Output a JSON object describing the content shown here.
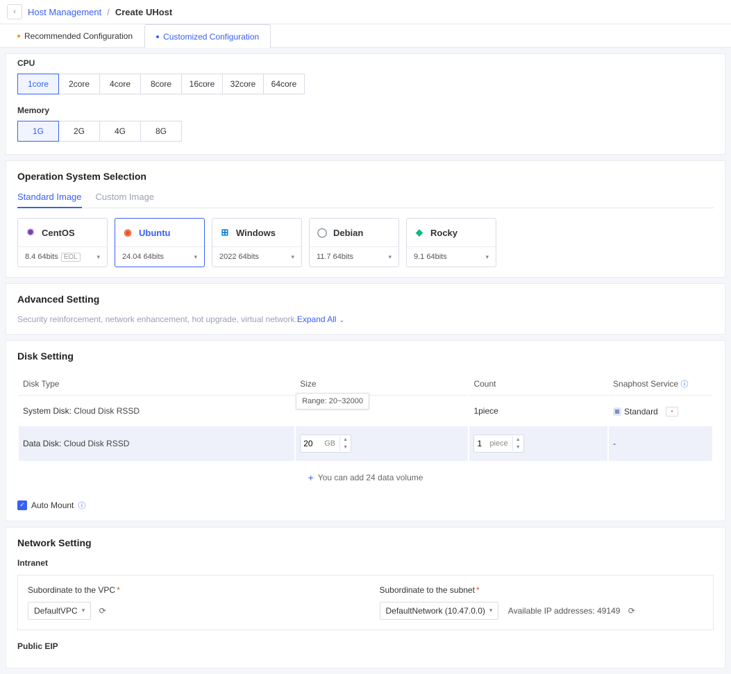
{
  "breadcrumb": {
    "parent": "Host Management",
    "sep": "/",
    "current": "Create UHost"
  },
  "tabs": {
    "recommended": "Recommended Configuration",
    "customized": "Customized Configuration"
  },
  "cpu": {
    "label": "CPU",
    "options": [
      "1core",
      "2core",
      "4core",
      "8core",
      "16core",
      "32core",
      "64core"
    ]
  },
  "memory": {
    "label": "Memory",
    "options": [
      "1G",
      "2G",
      "4G",
      "8G"
    ]
  },
  "os": {
    "title": "Operation System Selection",
    "subtabs": {
      "standard": "Standard Image",
      "custom": "Custom Image"
    },
    "cards": [
      {
        "name": "CentOS",
        "version": "8.4 64bits",
        "eol": "EOL",
        "color": "#7b3fb9"
      },
      {
        "name": "Ubuntu",
        "version": "24.04 64bits",
        "color": "#e95420"
      },
      {
        "name": "Windows",
        "version": "2022 64bits",
        "color": "#0078d6"
      },
      {
        "name": "Debian",
        "version": "11.7 64bits",
        "color": "#85909b"
      },
      {
        "name": "Rocky",
        "version": "9.1 64bits",
        "color": "#10b981"
      }
    ]
  },
  "advanced": {
    "title": "Advanced Setting",
    "subtitle": "Security reinforcement, network enhancement, hot upgrade, virtual network.",
    "expand": "Expand All"
  },
  "disk": {
    "title": "Disk Setting",
    "headers": {
      "type": "Disk Type",
      "size": "Size",
      "count": "Count",
      "snapshot": "Snaphost Service"
    },
    "system": {
      "label": "System Disk:",
      "val": "Cloud Disk RSSD",
      "count": "1piece",
      "snap": "Standard"
    },
    "tooltip": "Range: 20~32000",
    "data_row": {
      "label": "Data Disk:",
      "val": "Cloud Disk RSSD",
      "size": "20",
      "unit": "GB",
      "count": "1",
      "count_unit": "piece",
      "snap": "-"
    },
    "add_volume": "You can add 24 data volume",
    "auto_mount": "Auto Mount"
  },
  "network": {
    "title": "Network Setting",
    "intranet": "Intranet",
    "vpc_label": "Subordinate to the VPC",
    "vpc_value": "DefaultVPC",
    "subnet_label": "Subordinate to the subnet",
    "subnet_value": "DefaultNetwork (10.47.0.0)",
    "avail_ip": "Available IP addresses: 49149",
    "public_eip": "Public EIP"
  }
}
